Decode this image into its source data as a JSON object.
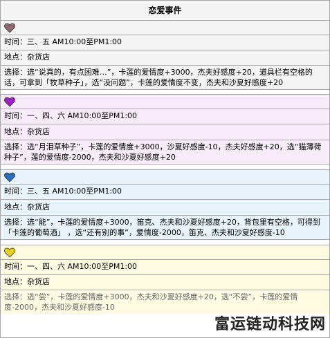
{
  "page_title": "恋爱事件",
  "events": [
    {
      "heart_color": "#8b6b6b",
      "time": "时间：三、五 AM10:00至PM1:00",
      "place": "地点：杂货店",
      "choice": "选择：选“说真的，有点困难…”，卡莲的爱情度+3000，杰夫好感度+20，道具栏有空格的话，可拿到「牧草种子」，选“没问题”，卡莲的爱情度不变，杰夫和沙夏好感度+20"
    },
    {
      "heart_color": "#a020c8",
      "time": "时间：一、四、六 AM10:00至PM1:00",
      "place": "地点：杂货店",
      "choice": "选择：选“月泪草种子”，卡莲的爱情度+3000，沙夏好感度-10，杰夫好感度+20，选“猫薄荷种子”，莲的爱情度-2000，杰夫和沙夏好感度+20"
    },
    {
      "heart_color": "#2a6fc0",
      "time": "时间：三、五 AM10:00至PM1:00",
      "place": "地点：杂货店",
      "choice": "选择：选“能”，卡莲的爱情度+3000，笛克、杰夫和沙夏好感度+20，背包里有空格，可得到「卡莲的葡萄酒」 ，选“还有别的事”，爱情度-2000，笛克、杰夫和沙夏好感度-10"
    },
    {
      "heart_color": "#e8d020",
      "time": "时间：一、四、六 AM10:00至PM1:00",
      "place": "地点：杂货店",
      "choice": "选择：选“尝”，卡莲的爱情度+3000，杰夫和沙夏好感度+20，选“不尝”，卡莲的爱情度-2000，杰夫和沙夏好感度-10"
    }
  ],
  "watermark": "富运链动科技网"
}
